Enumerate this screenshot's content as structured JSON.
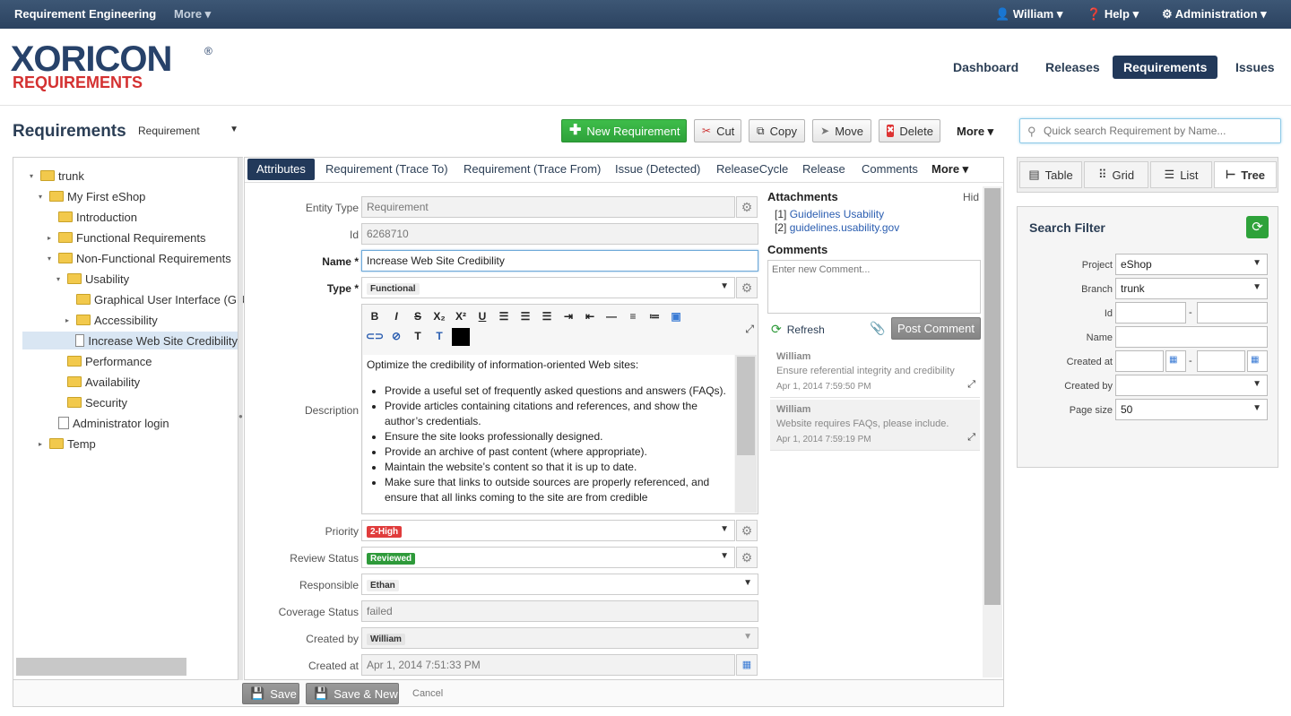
{
  "topbar": {
    "app_title": "Requirement Engineering",
    "more": "More",
    "user": "William",
    "help": "Help",
    "admin": "Administration"
  },
  "logo": {
    "main": "XORICON",
    "sub": "REQUIREMENTS",
    "reg": "®"
  },
  "nav": [
    "Dashboard",
    "Releases",
    "Requirements",
    "Issues"
  ],
  "page": {
    "title": "Requirements",
    "type_select": "Requirement",
    "buttons": {
      "new": "New Requirement",
      "cut": "Cut",
      "copy": "Copy",
      "move": "Move",
      "delete": "Delete",
      "more": "More"
    },
    "search_placeholder": "Quick search Requirement by Name..."
  },
  "tree": [
    {
      "label": "trunk",
      "icon": "folder"
    },
    {
      "label": "My First eShop",
      "icon": "folder"
    },
    {
      "label": "Introduction",
      "icon": "folder"
    },
    {
      "label": "Functional Requirements",
      "icon": "folder"
    },
    {
      "label": "Non-Functional Requirements",
      "icon": "folder"
    },
    {
      "label": "Usability",
      "icon": "folder"
    },
    {
      "label": "Graphical User Interface (GU",
      "icon": "folder"
    },
    {
      "label": "Accessibility",
      "icon": "folder"
    },
    {
      "label": "Increase Web Site Credibility",
      "icon": "doc"
    },
    {
      "label": "Performance",
      "icon": "folder"
    },
    {
      "label": "Availability",
      "icon": "folder"
    },
    {
      "label": "Security",
      "icon": "folder"
    },
    {
      "label": "Administrator login",
      "icon": "doc"
    },
    {
      "label": "Temp",
      "icon": "folder"
    }
  ],
  "tabs": [
    "Attributes",
    "Requirement (Trace To)",
    "Requirement (Trace From)",
    "Issue (Detected)",
    "ReleaseCycle",
    "Release",
    "Comments",
    "More"
  ],
  "form": {
    "entity_type": {
      "label": "Entity Type",
      "value": "Requirement"
    },
    "id": {
      "label": "Id",
      "value": "6268710"
    },
    "name": {
      "label": "Name",
      "value": "Increase Web Site Credibility"
    },
    "type": {
      "label": "Type",
      "value": "Functional"
    },
    "description": {
      "label": "Description",
      "intro": "Optimize the credibility of information-oriented Web sites:",
      "items": [
        "Provide a useful set of frequently asked questions and answers (FAQs).",
        "Provide articles containing citations and references, and show the author’s credentials.",
        "Ensure the site looks professionally designed.",
        "Provide an archive of past content (where appropriate).",
        "Maintain the website’s content so that it is up to date.",
        "Make sure that links to outside sources are properly referenced, and ensure that all links coming to the site are from credible"
      ]
    },
    "priority": {
      "label": "Priority",
      "value": "2-High",
      "color": "#e03c3c"
    },
    "review_status": {
      "label": "Review Status",
      "value": "Reviewed",
      "color": "#2e9a3a"
    },
    "responsible": {
      "label": "Responsible",
      "value": "Ethan"
    },
    "coverage_status": {
      "label": "Coverage Status",
      "value": "failed"
    },
    "created_by": {
      "label": "Created by",
      "value": "William"
    },
    "created_at": {
      "label": "Created at",
      "value": "Apr 1, 2014 7:51:33 PM"
    }
  },
  "attachments": {
    "title": "Attachments",
    "hide": "Hid",
    "items": [
      {
        "num": "[1]",
        "text": "Guidelines Usability"
      },
      {
        "num": "[2]",
        "text": "guidelines.usability.gov"
      }
    ]
  },
  "comments": {
    "title": "Comments",
    "placeholder": "Enter new Comment...",
    "refresh": "Refresh",
    "post": "Post Comment",
    "items": [
      {
        "author": "William",
        "text": "Ensure referential integrity and credibility",
        "date": "Apr 1, 2014 7:59:50 PM"
      },
      {
        "author": "William",
        "text": "Website requires FAQs, please include.",
        "date": "Apr 1, 2014 7:59:19 PM"
      }
    ]
  },
  "footer": {
    "save": "Save",
    "save_new": "Save & New",
    "cancel": "Cancel"
  },
  "views": [
    "Table",
    "Grid",
    "List",
    "Tree"
  ],
  "filter": {
    "title": "Search Filter",
    "project": {
      "label": "Project",
      "value": "eShop"
    },
    "branch": {
      "label": "Branch",
      "value": "trunk"
    },
    "id": {
      "label": "Id",
      "sep": "-"
    },
    "name": {
      "label": "Name"
    },
    "created_at": {
      "label": "Created at",
      "sep": "-"
    },
    "created_by": {
      "label": "Created by"
    },
    "page_size": {
      "label": "Page size",
      "value": "50"
    }
  }
}
